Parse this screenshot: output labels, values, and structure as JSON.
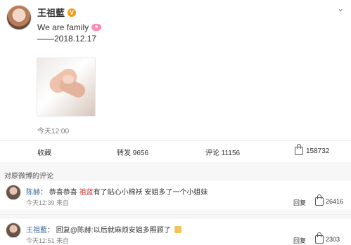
{
  "post": {
    "author": "王祖藍",
    "badge": "V",
    "more_icon": "chevron-down-icon",
    "text_line": "We are family",
    "date_line": "——2018.12.17",
    "time": "今天12:00"
  },
  "actions": {
    "collect_label": "收藏",
    "repost_label": "转发 9656",
    "comment_label": "评论 11156",
    "like_count": "158732"
  },
  "comments": {
    "title": "对原微博的评论",
    "items": [
      {
        "user": "陈赫",
        "sep": "：",
        "text_prefix": "恭喜恭喜 ",
        "mention": "祖蓝",
        "text_suffix": "有了贴心小棉袄 安姐多了一个小姐妹",
        "time": "今天12:39 来自",
        "reply": "回复",
        "likes": "26416"
      },
      {
        "user": "王祖藍",
        "sep": "：",
        "text": "回复@陈赫:以后就麻烦安姐多照顾了",
        "time": "今天12:51 来自",
        "reply": "回复",
        "likes": "2303"
      }
    ]
  },
  "colors": {
    "link": "#3b6aa0",
    "mention": "#cc3333",
    "badge": "#f39c12"
  }
}
